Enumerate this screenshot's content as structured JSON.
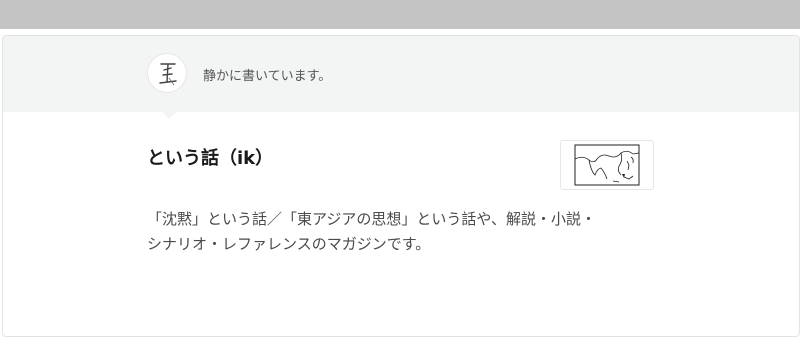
{
  "magazine": {
    "tagline": "静かに書いています。",
    "avatar_icon": "calligraphy-logo-icon",
    "title": "という話（ik）",
    "thumbnail_icon": "east-asia-map-icon",
    "description_line1": "「沈黙」という話／「東アジアの思想」という話や、解説・小説・",
    "description_line2": "シナリオ・レファレンスのマガジンです。"
  },
  "colors": {
    "top_bar": "#c4c4c4",
    "header_bg": "#f3f5f4",
    "title_text": "#1a1a1a",
    "body_text": "#4a4a4a"
  }
}
